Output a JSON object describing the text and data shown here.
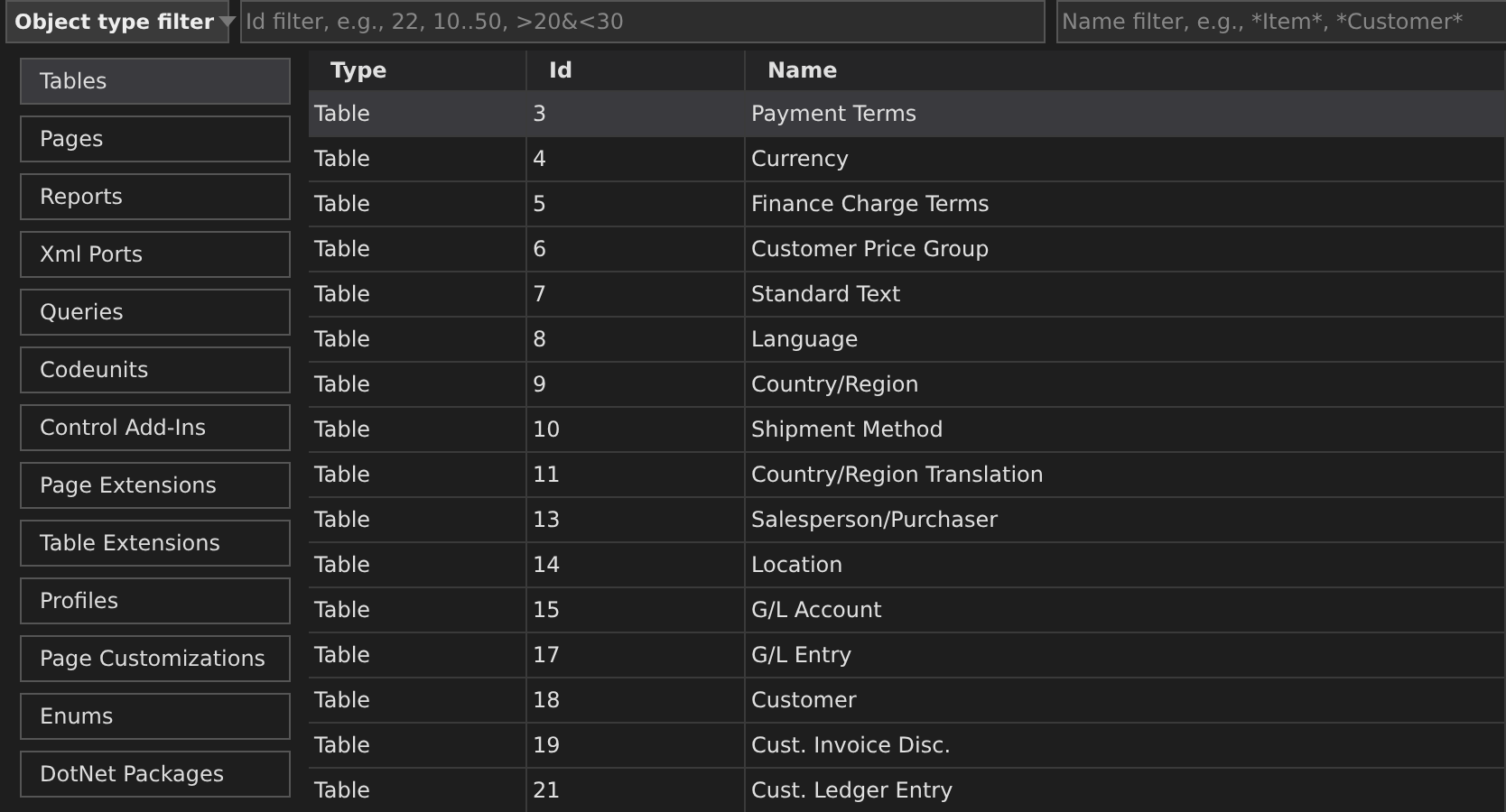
{
  "toolbar": {
    "type_filter": {
      "label": "Object type filter"
    },
    "id_filter": {
      "placeholder": "Id filter, e.g., 22, 10..50, >20&<30"
    },
    "name_filter": {
      "placeholder": "Name filter, e.g., *Item*, *Customer*"
    }
  },
  "sidebar": {
    "items": [
      {
        "label": "Tables",
        "selected": true
      },
      {
        "label": "Pages",
        "selected": false
      },
      {
        "label": "Reports",
        "selected": false
      },
      {
        "label": "Xml Ports",
        "selected": false
      },
      {
        "label": "Queries",
        "selected": false
      },
      {
        "label": "Codeunits",
        "selected": false
      },
      {
        "label": "Control Add-Ins",
        "selected": false
      },
      {
        "label": "Page Extensions",
        "selected": false
      },
      {
        "label": "Table Extensions",
        "selected": false
      },
      {
        "label": "Profiles",
        "selected": false
      },
      {
        "label": "Page Customizations",
        "selected": false
      },
      {
        "label": "Enums",
        "selected": false
      },
      {
        "label": "DotNet Packages",
        "selected": false
      }
    ]
  },
  "table": {
    "columns": [
      "Type",
      "Id",
      "Name"
    ],
    "rows": [
      {
        "type": "Table",
        "id": "3",
        "name": "Payment Terms",
        "selected": true
      },
      {
        "type": "Table",
        "id": "4",
        "name": "Currency",
        "selected": false
      },
      {
        "type": "Table",
        "id": "5",
        "name": "Finance Charge Terms",
        "selected": false
      },
      {
        "type": "Table",
        "id": "6",
        "name": "Customer Price Group",
        "selected": false
      },
      {
        "type": "Table",
        "id": "7",
        "name": "Standard Text",
        "selected": false
      },
      {
        "type": "Table",
        "id": "8",
        "name": "Language",
        "selected": false
      },
      {
        "type": "Table",
        "id": "9",
        "name": "Country/Region",
        "selected": false
      },
      {
        "type": "Table",
        "id": "10",
        "name": "Shipment Method",
        "selected": false
      },
      {
        "type": "Table",
        "id": "11",
        "name": "Country/Region Translation",
        "selected": false
      },
      {
        "type": "Table",
        "id": "13",
        "name": "Salesperson/Purchaser",
        "selected": false
      },
      {
        "type": "Table",
        "id": "14",
        "name": "Location",
        "selected": false
      },
      {
        "type": "Table",
        "id": "15",
        "name": "G/L Account",
        "selected": false
      },
      {
        "type": "Table",
        "id": "17",
        "name": "G/L Entry",
        "selected": false
      },
      {
        "type": "Table",
        "id": "18",
        "name": "Customer",
        "selected": false
      },
      {
        "type": "Table",
        "id": "19",
        "name": "Cust. Invoice Disc.",
        "selected": false
      },
      {
        "type": "Table",
        "id": "21",
        "name": "Cust. Ledger Entry",
        "selected": false
      }
    ]
  }
}
